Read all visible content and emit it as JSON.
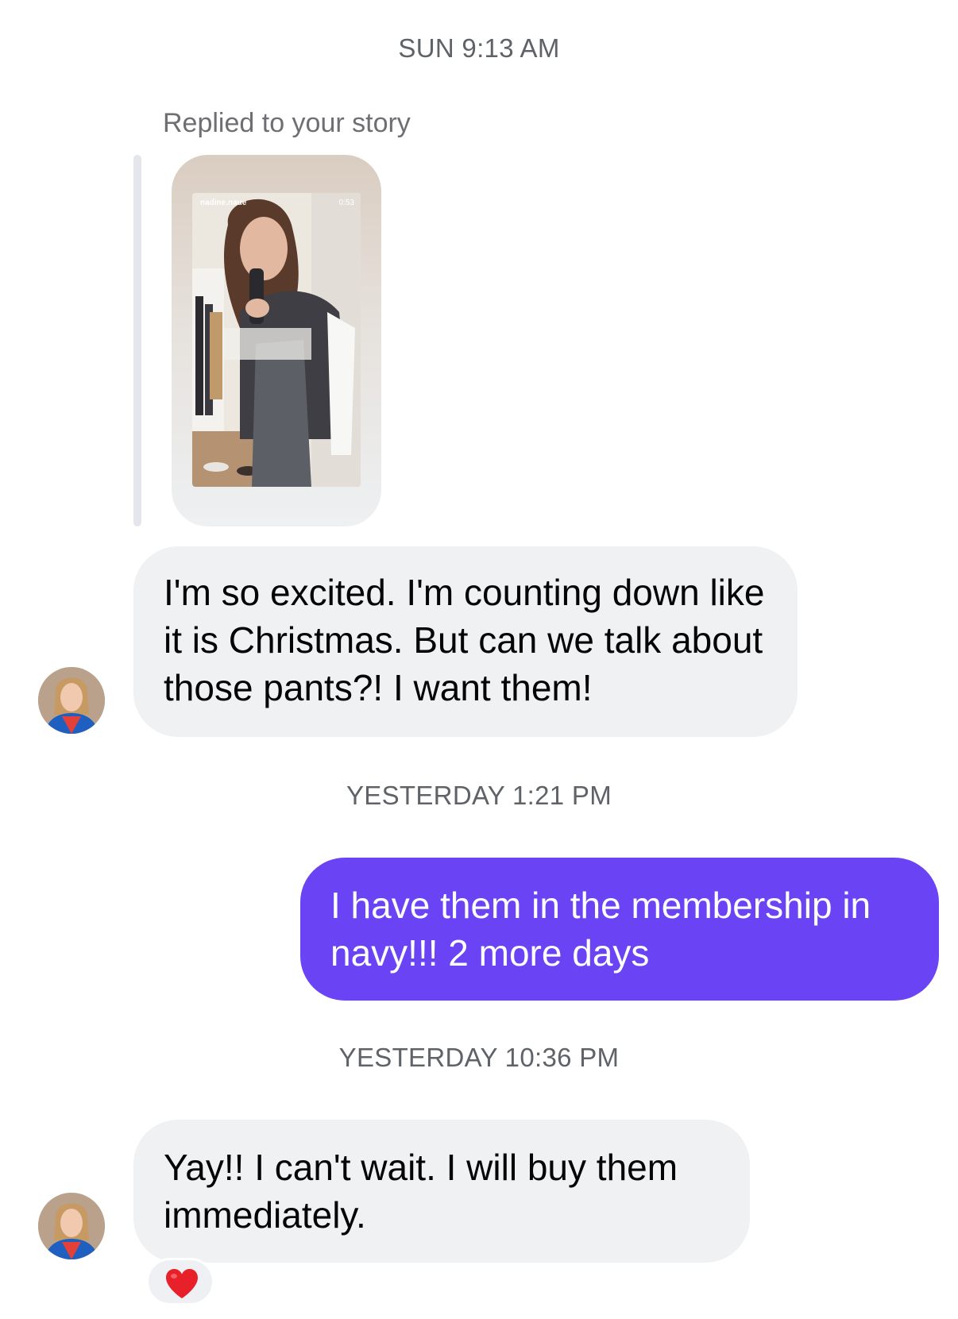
{
  "colors": {
    "outgoing_bubble": "#6a43f5",
    "incoming_bubble": "#f0f1f3",
    "timestamp_text": "#5f6368",
    "reaction_heart": "#e8202a"
  },
  "conversation": [
    {
      "type": "timestamp",
      "text": "SUN 9:13 AM"
    },
    {
      "type": "story_reply",
      "label": "Replied to your story",
      "story": {
        "username": "nadine.naue",
        "duration": "0:53"
      }
    },
    {
      "type": "message",
      "direction": "incoming",
      "avatar_icon": "user-avatar-icon",
      "text": "I'm so excited. I'm counting down like it is Christmas. But can we talk about those pants?! I want them!"
    },
    {
      "type": "timestamp",
      "text": "YESTERDAY 1:21 PM"
    },
    {
      "type": "message",
      "direction": "outgoing",
      "text": "I have them in the membership in navy!!! 2 more days"
    },
    {
      "type": "timestamp",
      "text": "YESTERDAY 10:36 PM"
    },
    {
      "type": "message",
      "direction": "incoming",
      "avatar_icon": "user-avatar-icon",
      "text": "Yay!! I can't wait. I will buy them immediately.",
      "reaction_icon": "heart-reaction-icon"
    }
  ]
}
